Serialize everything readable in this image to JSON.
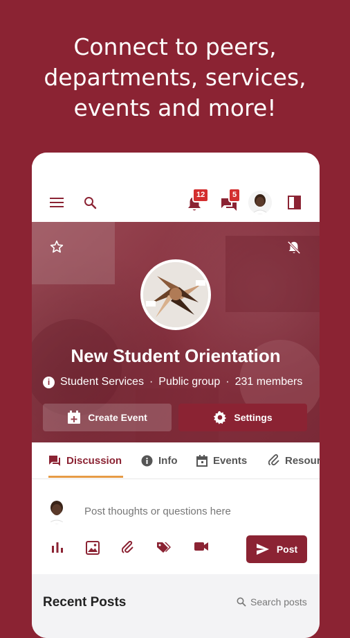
{
  "headline": {
    "line1": "Connect to peers,",
    "line2": "departments, services,",
    "line3": "events and more!"
  },
  "topbar": {
    "notifications_count": "12",
    "messages_count": "5"
  },
  "group": {
    "name": "New Student Orientation",
    "department": "Student Services",
    "privacy": "Public group",
    "members": "231 members",
    "separator": "·"
  },
  "actions": {
    "create_event": "Create Event",
    "settings": "Settings"
  },
  "tabs": [
    {
      "label": "Discussion",
      "icon": "chat-icon"
    },
    {
      "label": "Info",
      "icon": "info-icon"
    },
    {
      "label": "Events",
      "icon": "calendar-icon"
    },
    {
      "label": "Resour",
      "icon": "paperclip-icon"
    }
  ],
  "composer": {
    "placeholder": "Post thoughts or questions here",
    "post_label": "Post"
  },
  "recent": {
    "title": "Recent Posts",
    "search_label": "Search posts"
  },
  "colors": {
    "brand": "#8b2333",
    "accent": "#e69b45",
    "badge": "#d32f2f"
  }
}
